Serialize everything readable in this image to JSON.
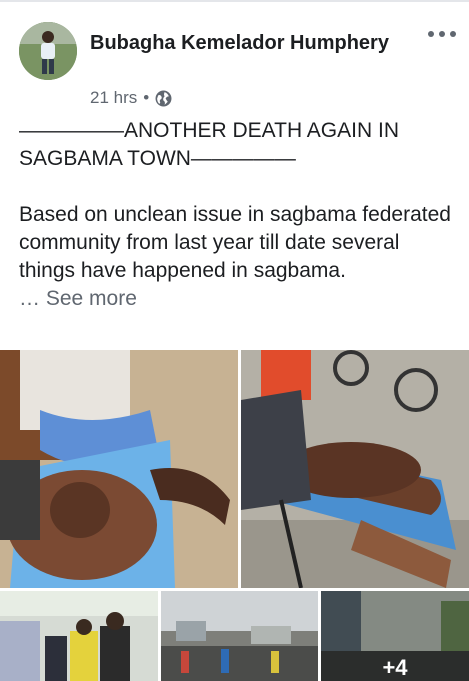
{
  "post": {
    "author": "Bubagha Kemelador Humphery",
    "timestamp": "21 hrs",
    "separator": "•",
    "privacy_icon": "globe-icon",
    "more_icon": "more-options-icon",
    "headline": "—————ANOTHER DEATH AGAIN IN SAGBAMA TOWN—————",
    "body": "Based on unclean issue in sagbama federated community from last year till date several things have happened in sagbama.",
    "see_more_prefix": "… ",
    "see_more": "See more"
  },
  "photos": {
    "extra_count_label": "+4"
  },
  "colors": {
    "text_primary": "#1c1e21",
    "text_secondary": "#606770",
    "divider": "#e4e6ea"
  }
}
